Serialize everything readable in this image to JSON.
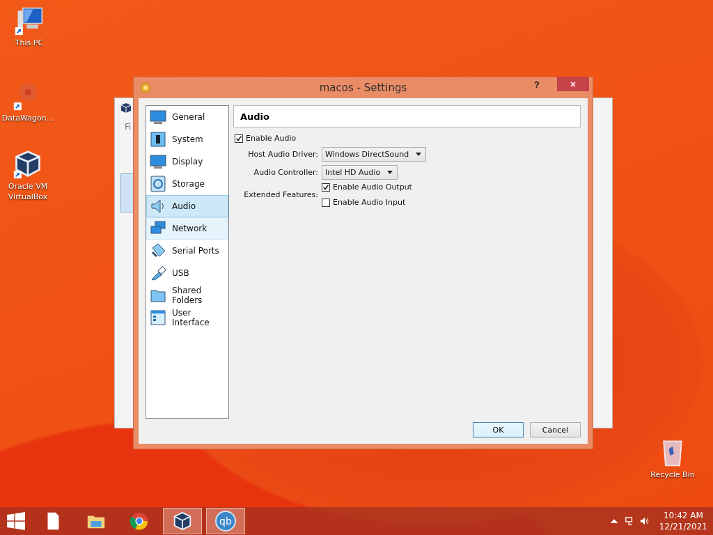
{
  "desktop_icons": [
    {
      "label": "This PC"
    },
    {
      "label": "DataWagon..."
    },
    {
      "label": "Oracle VM VirtualBox"
    },
    {
      "label": "Recycle Bin"
    }
  ],
  "background_window": {
    "menu_text": "Fi"
  },
  "window": {
    "title": "macos - Settings",
    "help": "?"
  },
  "sidebar": {
    "items": [
      {
        "label": "General",
        "selected": false,
        "hovered": false
      },
      {
        "label": "System",
        "selected": false,
        "hovered": false
      },
      {
        "label": "Display",
        "selected": false,
        "hovered": false
      },
      {
        "label": "Storage",
        "selected": false,
        "hovered": false
      },
      {
        "label": "Audio",
        "selected": true,
        "hovered": false
      },
      {
        "label": "Network",
        "selected": false,
        "hovered": true
      },
      {
        "label": "Serial Ports",
        "selected": false,
        "hovered": false
      },
      {
        "label": "USB",
        "selected": false,
        "hovered": false
      },
      {
        "label": "Shared Folders",
        "selected": false,
        "hovered": false
      },
      {
        "label": "User Interface",
        "selected": false,
        "hovered": false
      }
    ]
  },
  "page": {
    "heading": "Audio",
    "enable_audio": {
      "label": "Enable Audio",
      "checked": true
    },
    "host_audio_driver": {
      "label": "Host Audio Driver:",
      "value": "Windows DirectSound"
    },
    "audio_controller": {
      "label": "Audio Controller:",
      "value": "Intel HD Audio"
    },
    "extended_features": {
      "label": "Extended Features:",
      "options": [
        {
          "label": "Enable Audio Output",
          "checked": true
        },
        {
          "label": "Enable Audio Input",
          "checked": false
        }
      ]
    }
  },
  "buttons": [
    {
      "label": "OK",
      "default": true
    },
    {
      "label": "Cancel",
      "default": false
    }
  ],
  "taskbar": {
    "apps": [
      {
        "active": false
      },
      {
        "active": false
      },
      {
        "active": false
      },
      {
        "active": true
      },
      {
        "active": true,
        "label": "qb"
      }
    ],
    "time": "10:42 AM",
    "date": "12/21/2021"
  }
}
